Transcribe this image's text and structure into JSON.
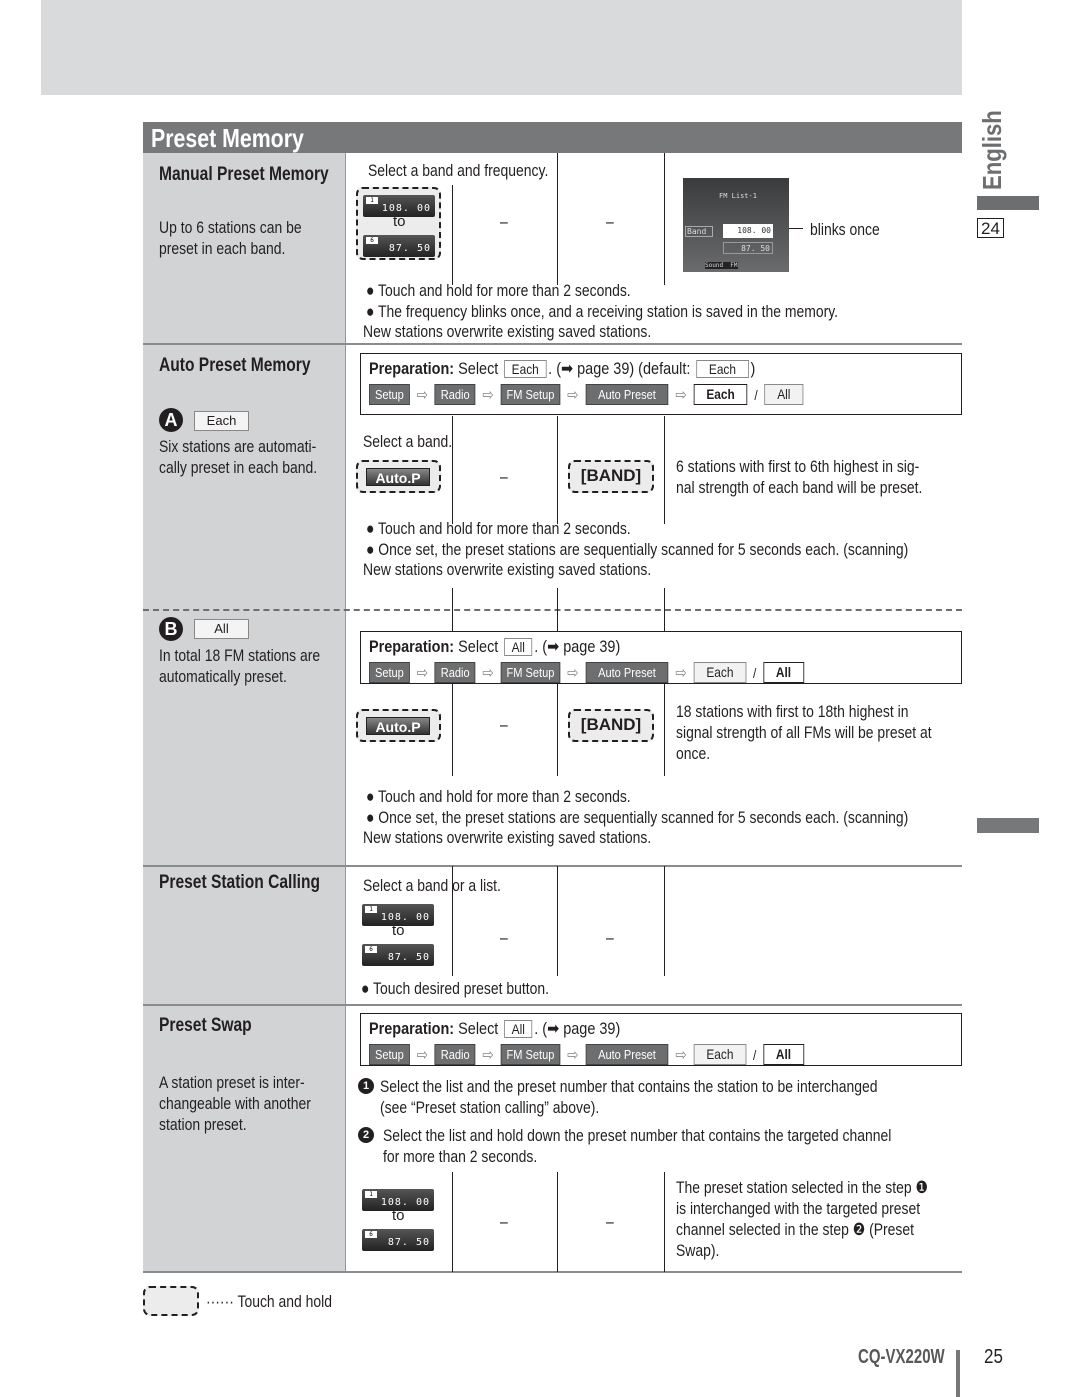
{
  "side": {
    "language": "English",
    "page_box": "24"
  },
  "title": "Preset Memory",
  "manual": {
    "heading": "Manual Preset Memory",
    "desc": [
      "Up to 6 stations can be",
      "preset in each band."
    ],
    "instruction": "Select a band and frequency.",
    "display_top": "108. 00",
    "display_to": "to",
    "display_bottom": "87. 50",
    "display_top_num": "1",
    "display_bottom_num": "6",
    "dash": "–",
    "screen": {
      "title": "FM List-1",
      "band": "Band",
      "freq1": "108. 00",
      "freq2": "87. 50",
      "bottom": "Sound  FM"
    },
    "blinks": "blinks once",
    "bullets": [
      "Touch and hold for more than 2 seconds.",
      "The frequency blinks once, and a receiving station is saved in the memory."
    ],
    "note": "New stations overwrite existing saved stations."
  },
  "auto": {
    "heading": "Auto Preset Memory",
    "a": {
      "letter": "A",
      "mode": "Each",
      "desc": [
        "Six stations are automati-",
        "cally preset in each band."
      ],
      "prep": {
        "label": "Preparation:",
        "select": "Select",
        "value": "Each",
        "ref": ". (➡ page 39) (default:",
        "default": "Each",
        "close": ")"
      },
      "instruction": "Select a band.",
      "autop": "Auto.P",
      "dash": "–",
      "band": "[BAND]",
      "result": [
        "6 stations with first to 6th highest in sig-",
        "nal strength of each band will be preset."
      ],
      "bullets": [
        "Touch and hold for more than 2 seconds.",
        "Once set, the preset stations are sequentially scanned for 5 seconds each. (scanning)"
      ],
      "note": "New stations overwrite existing saved stations."
    },
    "b": {
      "letter": "B",
      "mode": "All",
      "desc": [
        "In total 18 FM stations are",
        "automatically preset."
      ],
      "prep": {
        "label": "Preparation:",
        "select": "Select",
        "value": "All",
        "ref": ". (➡ page 39)"
      },
      "autop": "Auto.P",
      "dash": "–",
      "band": "[BAND]",
      "result": [
        "18 stations with first to 18th highest in",
        "signal strength of all FMs will be preset at",
        "once."
      ],
      "bullets": [
        "Touch and hold for more than 2 seconds.",
        "Once set, the preset stations are sequentially scanned for 5 seconds each. (scanning)"
      ],
      "note": "New stations overwrite existing saved stations."
    }
  },
  "menu_path": [
    "Setup",
    "Radio",
    "FM Setup",
    "Auto Preset"
  ],
  "options": [
    "Each",
    "All"
  ],
  "slash": "/",
  "calling": {
    "heading": "Preset Station Calling",
    "instruction": "Select a band or a list.",
    "dash": "–",
    "bullet": "Touch desired preset button."
  },
  "swap": {
    "heading": "Preset Swap",
    "desc": [
      "A station preset is inter-",
      "changeable with another",
      "station preset."
    ],
    "prep": {
      "label": "Preparation:",
      "select": "Select",
      "value": "All",
      "ref": ". (➡ page 39)"
    },
    "steps": [
      {
        "num": "1",
        "lines": [
          "Select the list and the preset number that contains the station to be interchanged",
          "(see “Preset station calling” above)."
        ]
      },
      {
        "num": "2",
        "lines": [
          "Select the list and hold down the preset number that contains the targeted channel",
          "for more than 2 seconds."
        ]
      }
    ],
    "dash": "–",
    "result": [
      "The preset station selected in the step ❶",
      "is interchanged with the targeted preset",
      "channel selected in the step ❷ (Preset",
      "Swap)."
    ]
  },
  "legend": "······ Touch and hold",
  "footer": {
    "model": "CQ-VX220W",
    "page": "25"
  }
}
